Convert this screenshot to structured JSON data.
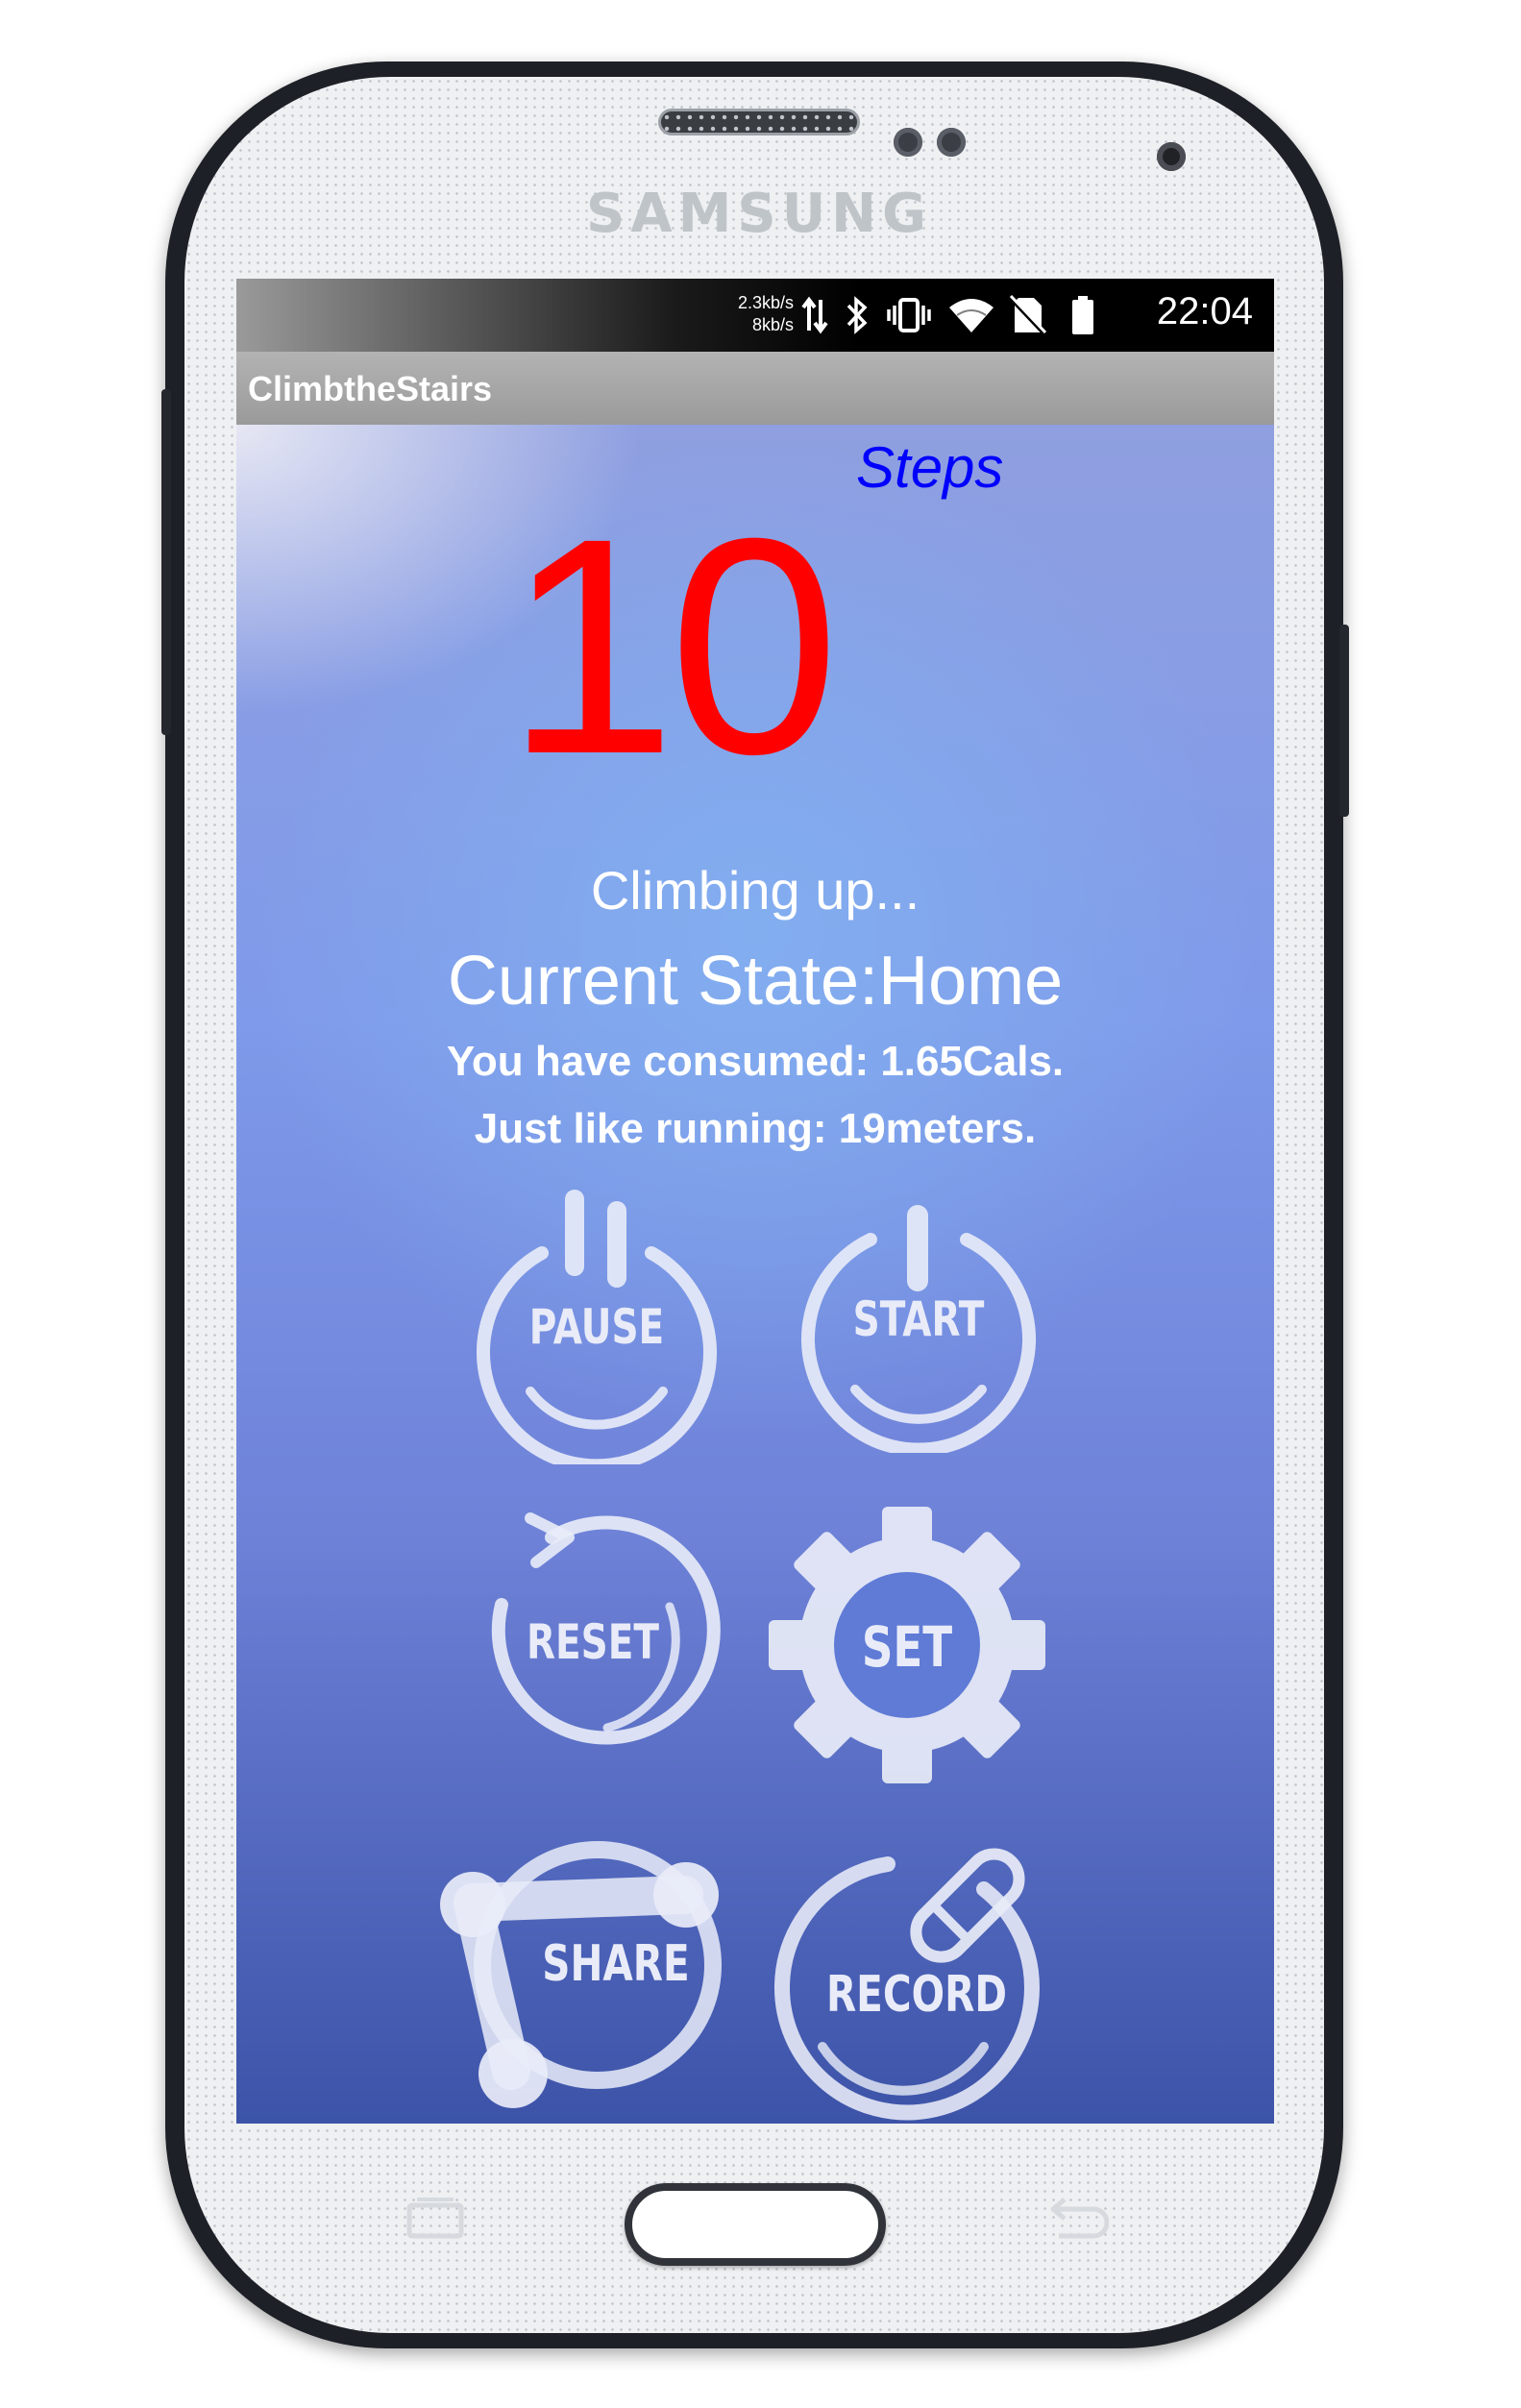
{
  "device": {
    "brand": "SAMSUNG",
    "icons": [
      "speaker-grille",
      "proximity-sensor",
      "front-camera",
      "home-button",
      "recent-apps-icon",
      "back-icon"
    ]
  },
  "status_bar": {
    "net_speed_up": "2.3kb/s",
    "net_speed_down": "8kb/s",
    "icons": [
      "data-transfer-icon",
      "bluetooth-icon",
      "vibrate-icon",
      "wifi-icon",
      "no-sim-icon",
      "battery-icon"
    ],
    "time": "22:04"
  },
  "app_bar": {
    "title": "ClimbtheStairs"
  },
  "main": {
    "steps_label": "Steps",
    "step_count": "10",
    "activity": "Climbing up...",
    "current_state": "Current State:Home",
    "calories": "You have consumed: 1.65Cals.",
    "distance": "Just like running: 19meters."
  },
  "buttons": {
    "pause": "PAUSE",
    "start": "START",
    "reset": "RESET",
    "set": "SET",
    "share": "SHARE",
    "record": "RECORD"
  },
  "colors": {
    "step_count": "#ff0000",
    "steps_label": "#0000ff",
    "text": "#ffffff",
    "button_tint": "#e9ecf8"
  }
}
